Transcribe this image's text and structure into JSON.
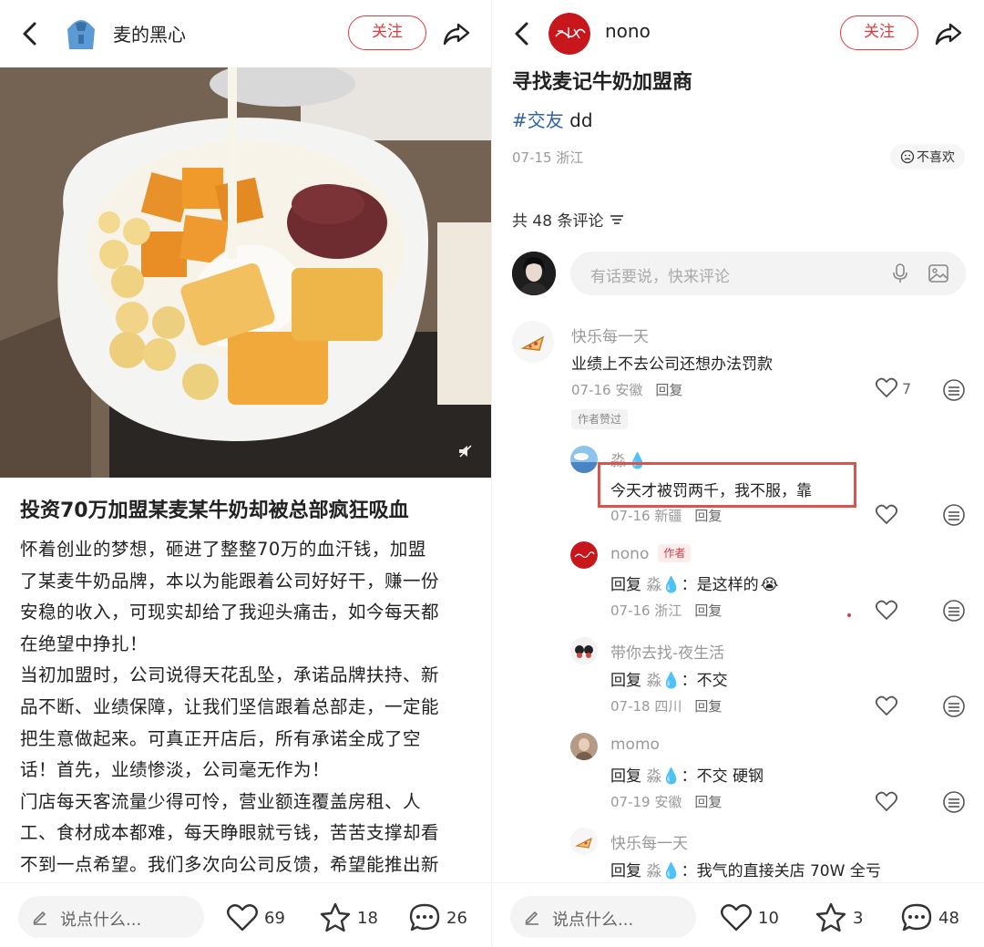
{
  "left": {
    "author_name": "麦的黑心",
    "follow_label": "关注",
    "post_title": "投资70万加盟某麦某牛奶却被总部疯狂吸血",
    "post_body": [
      "怀着创业的梦想，砸进了整整70万的血汗钱，加盟",
      "了某麦牛奶品牌，本以为能跟着公司好好干，赚一份",
      "安稳的收入，可现实却给了我迎头痛击，如今每天都",
      "在绝望中挣扎！",
      "当初加盟时，公司说得天花乱坠，承诺品牌扶持、新",
      "品不断、业绩保障，让我们坚信跟着总部走，一定能",
      "把生意做起来。可真正开店后，所有承诺全成了空",
      "话！首先，业绩惨淡，公司毫无作为！",
      "门店每天客流量少得可怜，营业额连覆盖房租、人",
      "工、食材成本都难，每天睁眼就亏钱，苦苦支撑却看",
      "不到一点希望。我们多次向公司反馈，希望能推出新"
    ],
    "bottom": {
      "say_placeholder": "说点什么...",
      "likes": "69",
      "stars": "18",
      "comments": "26"
    }
  },
  "right": {
    "author_name": "nono",
    "follow_label": "关注",
    "post_title": "寻找麦记牛奶加盟商",
    "tag": "#交友",
    "tag_extra": " dd",
    "meta": "07-15 浙江",
    "dislike_label": "不喜欢",
    "comment_count": "共 48 条评论",
    "comment_placeholder": "有话要说，快来评论",
    "comments": [
      {
        "name": "快乐每一天",
        "text": "业绩上不去公司还想办法罚款",
        "date": "07-16 安徽",
        "reply": "回复",
        "likes": "7",
        "author_liked": "作者赞过"
      },
      {
        "name": "淼",
        "text": "今天才被罚两千，我不服，靠",
        "date": "07-16 新疆",
        "reply": "回复"
      },
      {
        "name": "nono",
        "badge": "作者",
        "reply_prefix": "回复",
        "reply_to": "淼",
        "text": "：是这样的",
        "date": "07-16 浙江",
        "reply": "回复"
      },
      {
        "name": "带你去找-夜生活",
        "reply_prefix": "回复",
        "reply_to": "淼",
        "text": "：不交",
        "date": "07-18 四川",
        "reply": "回复"
      },
      {
        "name": "momo",
        "reply_prefix": "回复",
        "reply_to": "淼",
        "text": "：不交 硬钢",
        "date": "07-19 安徽",
        "reply": "回复"
      },
      {
        "name": "快乐每一天",
        "reply_prefix": "回复",
        "reply_to": "淼",
        "text": "：我气的直接关店 70W 全亏"
      }
    ],
    "bottom": {
      "say_placeholder": "说点什么...",
      "likes": "10",
      "stars": "3",
      "comments": "48"
    }
  },
  "colors": {
    "accent": "#e03a3e",
    "tag_blue": "#2e63a8",
    "highlight": "#d9534f"
  }
}
